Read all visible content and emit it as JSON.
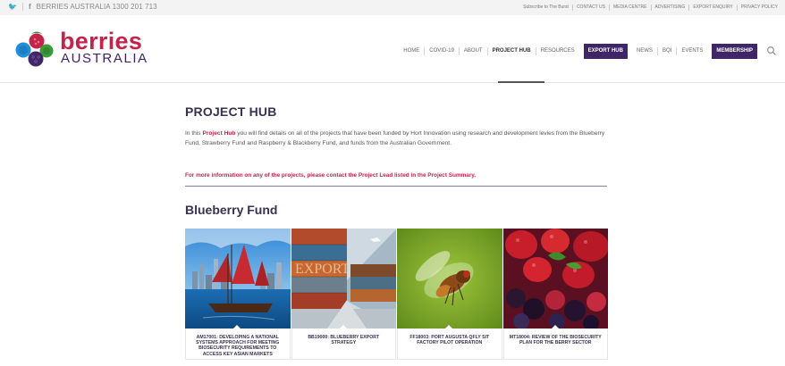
{
  "topbar": {
    "phone": "BERRIES AUSTRALIA 1300 201 713",
    "links": [
      "Subscribe to The Burst",
      "CONTACT US",
      "MEDIA CENTRE",
      "ADVERTISING",
      "EXPORT ENQUIRY",
      "PRIVACY POLICY"
    ]
  },
  "brand": {
    "line1": "berries",
    "line2": "AUSTRALIA",
    "colors": {
      "berry": "#c4244a",
      "purple": "#3f2666",
      "blue": "#1e8fd8",
      "green": "#3a9b38"
    }
  },
  "nav": {
    "items": [
      "HOME",
      "COVID-19",
      "ABOUT",
      "PROJECT HUB",
      "RESOURCES"
    ],
    "export_hub": "EXPORT HUB",
    "items2": [
      "NEWS",
      "BQI",
      "EVENTS"
    ],
    "membership": "MEMBERSHIP",
    "active": "PROJECT HUB"
  },
  "main": {
    "title": "PROJECT HUB",
    "intro_prefix": "In this ",
    "intro_link": "Project Hub",
    "intro_suffix": " you will find details on all of the projects that have been funded by Hort Innovation using research and development levies from the Blueberry Fund, Strawberry Fund and Raspberry & Blackberry Fund, and funds from the Australian Government.",
    "notice": "For more information on any of the projects, please contact the Project Lead listed in the Project Summary.",
    "fund_title": "Blueberry Fund",
    "cards": [
      {
        "caption": "AM17001: DEVELOPING A NATIONAL SYSTEMS APPROACH FOR MEETING BIOSECURITY REQUIREMENTS TO ACCESS KEY ASIAN MARKETS",
        "image": "junk-boat-harbour"
      },
      {
        "caption": "BB19000: BLUEBERRY EXPORT STRATEGY",
        "image": "export-containers"
      },
      {
        "caption": "FF18003: PORT AUGUSTA QFLY SIT FACTORY PILOT OPERATION",
        "image": "fruit-fly"
      },
      {
        "caption": "MT18004: REVIEW OF THE BIOSECURITY PLAN FOR THE BERRY SECTOR",
        "image": "mixed-berries"
      }
    ]
  }
}
